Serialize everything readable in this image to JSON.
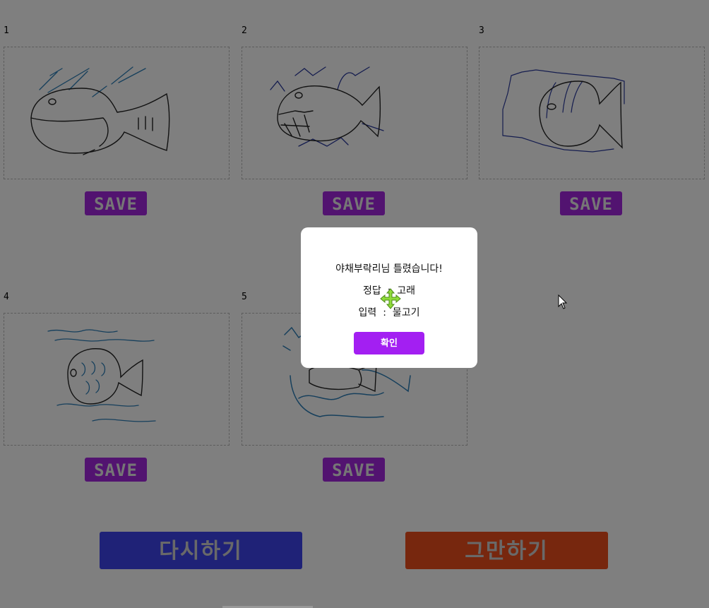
{
  "cards": [
    {
      "number": "1",
      "save_label": "SAVE",
      "drawing": "whale-fish-drawing"
    },
    {
      "number": "2",
      "save_label": "SAVE",
      "drawing": "toothy-fish-drawing"
    },
    {
      "number": "3",
      "save_label": "SAVE",
      "drawing": "striped-fish-drawing"
    },
    {
      "number": "4",
      "save_label": "SAVE",
      "drawing": "scaled-fish-drawing"
    },
    {
      "number": "5",
      "save_label": "SAVE",
      "drawing": "wave-fish-drawing"
    }
  ],
  "buttons": {
    "retry_label": "다시하기",
    "quit_label": "그만하기"
  },
  "modal": {
    "message": "야채부락리님 틀렸습니다!",
    "answer_line": "정답  :  고래",
    "input_line": "입력  :  물고기",
    "confirm_label": "확인"
  },
  "colors": {
    "save_button": "#a526e0",
    "retry_button": "#3f44ee",
    "quit_button": "#ef4f1c",
    "confirm_button": "#a31ff2",
    "overlay": "rgba(0,0,0,0.5)"
  },
  "icons": {
    "cursor": "move-cursor-icon",
    "pointer": "mouse-pointer-icon"
  }
}
